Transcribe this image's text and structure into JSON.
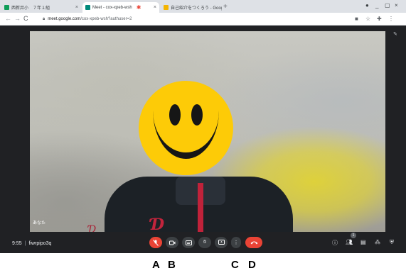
{
  "browser": {
    "tabs": [
      {
        "label": "西新井小　７年１組",
        "favicon_color": "#0f9d58",
        "active": false
      },
      {
        "label": "Meet - cox-xpeb-wsh",
        "favicon_color": "#00897b",
        "active": true
      },
      {
        "label": "自己紹介をつくろう - Google",
        "favicon_color": "#f4b400",
        "active": false
      }
    ],
    "close_glyph": "×",
    "new_tab_glyph": "+",
    "window_controls": [
      "●",
      "_",
      "▢",
      "×"
    ],
    "url_host": "meet.google.com",
    "url_path": "/cox-xpeb-wsh?authuser=2",
    "nav_icons": [
      "arrow-left-icon",
      "arrow-right-icon",
      "reload-icon"
    ],
    "toolbar_icons": [
      "video-indicator-icon",
      "star-icon",
      "extensions-icon",
      "menu-icon"
    ]
  },
  "meeting": {
    "time": "9:55",
    "separator": "|",
    "code": "fiwrpipo3q",
    "self_name": "あなた",
    "participant_count": "1",
    "colors": {
      "end_call": "#ea4335",
      "mic_off": "#ea4335",
      "control_bg": "#3c4043",
      "background": "#202124"
    }
  },
  "controls": {
    "center": [
      "mic-off",
      "camera",
      "captions",
      "raise-hand",
      "present",
      "more-options",
      "end-call"
    ],
    "right": [
      "meeting-details",
      "people",
      "chat",
      "activities",
      "host-controls"
    ]
  },
  "annotations": {
    "a": "A",
    "b": "B",
    "c": "C",
    "d": "D"
  }
}
